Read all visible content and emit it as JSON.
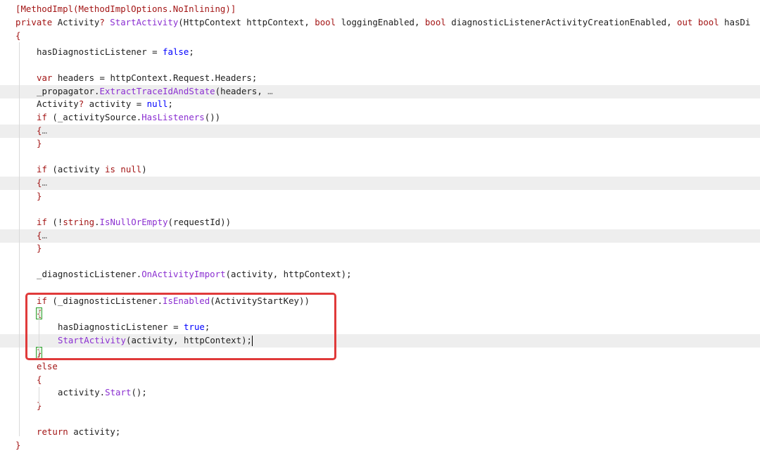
{
  "editor": {
    "lines": [
      {
        "segments": [
          [
            "attr",
            "[MethodImpl(MethodImplOptions.NoInlining)]"
          ]
        ]
      },
      {
        "segments": [
          [
            "kw",
            "private "
          ],
          [
            "dark",
            "Activity"
          ],
          [
            "kw",
            "? "
          ],
          [
            "fn",
            "StartActivity"
          ],
          [
            "dark",
            "(HttpContext httpContext, "
          ],
          [
            "kw",
            "bool "
          ],
          [
            "dark",
            "loggingEnabled, "
          ],
          [
            "kw",
            "bool "
          ],
          [
            "dark",
            "diagnosticListenerActivityCreationEnabled, "
          ],
          [
            "kw",
            "out bool "
          ],
          [
            "dark",
            "hasDi"
          ]
        ]
      },
      {
        "segments": [
          [
            "brace",
            "{"
          ]
        ]
      },
      {
        "segments": [
          [
            "dark",
            "hasDiagnosticListener "
          ],
          [
            "dark",
            "= "
          ],
          [
            "kw2",
            "false"
          ],
          [
            "dark",
            ";"
          ]
        ]
      },
      {
        "segments": []
      },
      {
        "segments": [
          [
            "kw",
            "var "
          ],
          [
            "dark",
            "headers = httpContext.Request.Headers;"
          ]
        ]
      },
      {
        "segments": [
          [
            "dark",
            "_propagator."
          ],
          [
            "fn",
            "ExtractTraceIdAndState"
          ],
          [
            "dark",
            "(headers, "
          ],
          [
            "ellipsis",
            "…"
          ]
        ]
      },
      {
        "segments": [
          [
            "dark",
            "Activity"
          ],
          [
            "kw",
            "? "
          ],
          [
            "dark",
            "activity = "
          ],
          [
            "kw2",
            "null"
          ],
          [
            "dark",
            ";"
          ]
        ]
      },
      {
        "segments": [
          [
            "kw",
            "if "
          ],
          [
            "dark",
            "(_activitySource."
          ],
          [
            "fn",
            "HasListeners"
          ],
          [
            "dark",
            "())"
          ]
        ]
      },
      {
        "segments": [
          [
            "brace",
            "{"
          ],
          [
            "ellipsis",
            "…"
          ]
        ]
      },
      {
        "segments": [
          [
            "brace",
            "}"
          ]
        ]
      },
      {
        "segments": []
      },
      {
        "segments": [
          [
            "kw",
            "if "
          ],
          [
            "dark",
            "(activity "
          ],
          [
            "kw",
            "is null"
          ],
          [
            "dark",
            ")"
          ]
        ]
      },
      {
        "segments": [
          [
            "brace",
            "{"
          ],
          [
            "ellipsis",
            "…"
          ]
        ]
      },
      {
        "segments": [
          [
            "brace",
            "}"
          ]
        ]
      },
      {
        "segments": []
      },
      {
        "segments": [
          [
            "kw",
            "if "
          ],
          [
            "dark",
            "(!"
          ],
          [
            "kw",
            "string"
          ],
          [
            "dark",
            "."
          ],
          [
            "fn",
            "IsNullOrEmpty"
          ],
          [
            "dark",
            "(requestId))"
          ]
        ]
      },
      {
        "segments": [
          [
            "brace",
            "{"
          ],
          [
            "ellipsis",
            "…"
          ]
        ]
      },
      {
        "segments": [
          [
            "brace",
            "}"
          ]
        ]
      },
      {
        "segments": []
      },
      {
        "segments": [
          [
            "dark",
            "_diagnosticListener."
          ],
          [
            "fn",
            "OnActivityImport"
          ],
          [
            "dark",
            "(activity, httpContext);"
          ]
        ]
      },
      {
        "segments": []
      },
      {
        "segments": [
          [
            "kw",
            "if "
          ],
          [
            "dark",
            "(_diagnosticListener."
          ],
          [
            "fn",
            "IsEnabled"
          ],
          [
            "dark",
            "(ActivityStartKey))"
          ]
        ]
      },
      {
        "segments": [
          [
            "brace",
            "{"
          ]
        ]
      },
      {
        "segments": [
          [
            "dark",
            "hasDiagnosticListener = "
          ],
          [
            "kw2",
            "true"
          ],
          [
            "dark",
            ";"
          ]
        ]
      },
      {
        "segments": [
          [
            "fn",
            "StartActivity"
          ],
          [
            "dark",
            "(activity, httpContext);"
          ]
        ]
      },
      {
        "segments": [
          [
            "brace",
            "}"
          ]
        ]
      },
      {
        "segments": [
          [
            "kw",
            "else"
          ]
        ]
      },
      {
        "segments": [
          [
            "brace",
            "{"
          ]
        ]
      },
      {
        "segments": [
          [
            "dark",
            "activity."
          ],
          [
            "fn",
            "Start"
          ],
          [
            "dark",
            "();"
          ]
        ]
      },
      {
        "segments": [
          [
            "brace",
            "}"
          ]
        ]
      },
      {
        "segments": []
      },
      {
        "segments": [
          [
            "kw",
            "return "
          ],
          [
            "dark",
            "activity;"
          ]
        ]
      },
      {
        "segments": [
          [
            "brace",
            "}"
          ]
        ]
      }
    ]
  }
}
